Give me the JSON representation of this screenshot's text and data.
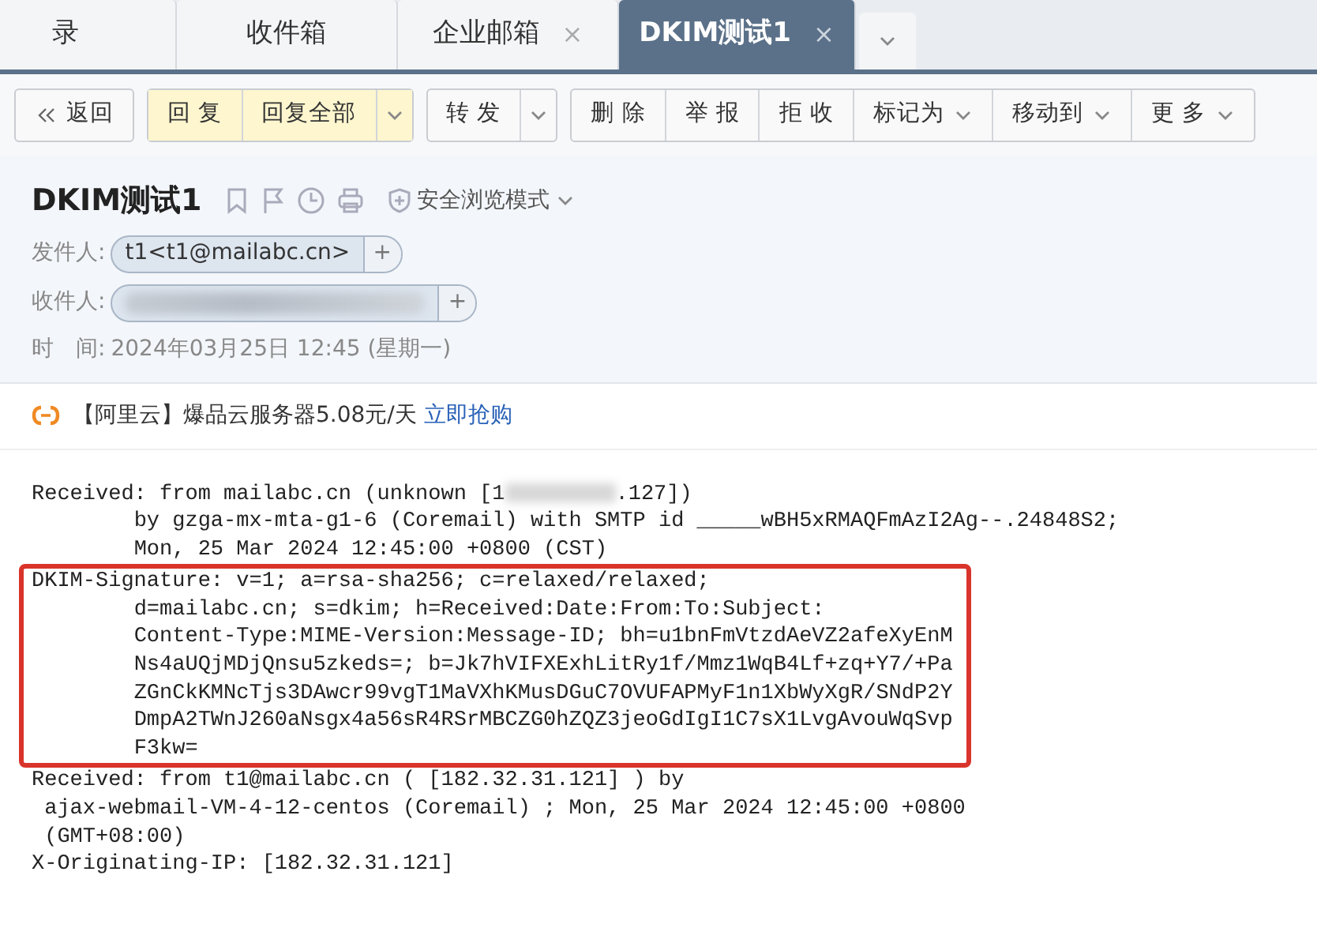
{
  "tabs": [
    {
      "label": "录",
      "selected": false,
      "closable": false
    },
    {
      "label": "收件箱",
      "selected": false,
      "closable": false
    },
    {
      "label": "企业邮箱",
      "selected": false,
      "closable": true
    },
    {
      "label": "DKIM测试1",
      "selected": true,
      "closable": true
    }
  ],
  "tab_close": "×",
  "toolbar": [
    {
      "kind": "back",
      "label": "返回"
    },
    {
      "kind": "group",
      "items": [
        {
          "label": "回 复",
          "highlight": true,
          "dropdown": false
        },
        {
          "label": "回复全部",
          "highlight": true,
          "dropdown": false
        },
        {
          "highlight": true,
          "dropdown": true
        }
      ]
    },
    {
      "kind": "group",
      "items": [
        {
          "label": "转 发",
          "highlight": false,
          "dropdown": false
        },
        {
          "highlight": false,
          "dropdown": true
        }
      ]
    },
    {
      "kind": "group",
      "items": [
        {
          "label": "删 除",
          "highlight": false,
          "dropdown": false
        },
        {
          "label": "举 报",
          "highlight": false,
          "dropdown": false
        },
        {
          "label": "拒 收",
          "highlight": false,
          "dropdown": false
        },
        {
          "label": "标记为",
          "highlight": false,
          "dropdown": true
        },
        {
          "label": "移动到",
          "highlight": false,
          "dropdown": true
        },
        {
          "label": "更 多",
          "highlight": false,
          "dropdown": true
        }
      ]
    }
  ],
  "subject": "DKIM测试1",
  "safe_mode": "安全浏览模式",
  "sender": {
    "label": "发件人:",
    "value": "t1<t1@mailabc.cn>",
    "add": "+",
    "redacted": false
  },
  "recipient": {
    "label": "收件人:",
    "add": "+",
    "redacted": true
  },
  "time": {
    "label": "时　间:",
    "value": "2024年03月25日 12:45 (星期一)"
  },
  "ad": {
    "text": "【阿里云】爆品云服务器5.08元/天",
    "link": "立即抢购"
  },
  "header_blocks": [
    {
      "highlighted": false,
      "lines": [
        {
          "kind": "redacted",
          "before": "Received: from mailabc.cn (unknown [1",
          "after": ".127])"
        },
        {
          "kind": "plain",
          "text": "\tby gzga-mx-mta-g1-6 (Coremail) with SMTP id _____wBH5xRMAQFmAzI2Ag--.24848S2;"
        },
        {
          "kind": "plain",
          "text": "\tMon, 25 Mar 2024 12:45:00 +0800 (CST)"
        }
      ]
    },
    {
      "highlighted": true,
      "lines": [
        {
          "kind": "plain",
          "text": "DKIM-Signature: v=1; a=rsa-sha256; c=relaxed/relaxed;"
        },
        {
          "kind": "plain",
          "text": "\td=mailabc.cn; s=dkim; h=Received:Date:From:To:Subject:"
        },
        {
          "kind": "plain",
          "text": "\tContent-Type:MIME-Version:Message-ID; bh=u1bnFmVtzdAeVZ2afeXyEnM"
        },
        {
          "kind": "plain",
          "text": "\tNs4aUQjMDjQnsu5zkeds=; b=Jk7hVIFXExhLitRy1f/Mmz1WqB4Lf+zq+Y7/+Pa"
        },
        {
          "kind": "plain",
          "text": "\tZGnCkKMNcTjs3DAwcr99vgT1MaVXhKMusDGuC7OVUFAPMyF1n1XbWyXgR/SNdP2Y"
        },
        {
          "kind": "plain",
          "text": "\tDmpA2TWnJ260aNsgx4a56sR4RSrMBCZG0hZQZ3jeoGdIgI1C7sX1LvgAvouWqSvp"
        },
        {
          "kind": "plain",
          "text": "\tF3kw="
        }
      ]
    },
    {
      "highlighted": false,
      "lines": [
        {
          "kind": "plain",
          "text": "Received: from t1@mailabc.cn ( [182.32.31.121] ) by"
        },
        {
          "kind": "plain",
          "text": " ajax-webmail-VM-4-12-centos (Coremail) ; Mon, 25 Mar 2024 12:45:00 +0800"
        },
        {
          "kind": "plain",
          "text": " (GMT+08:00)"
        },
        {
          "kind": "plain",
          "text": "X-Originating-IP: [182.32.31.121]"
        }
      ]
    }
  ]
}
